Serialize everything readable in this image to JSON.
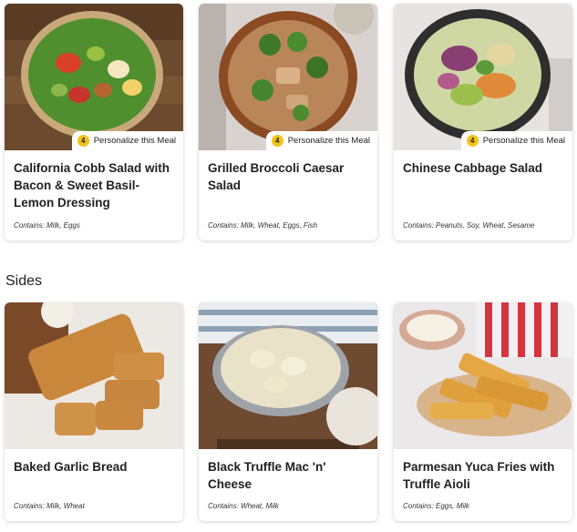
{
  "top_meals": [
    {
      "title": "California Cobb Salad with Bacon & Sweet Basil-Lemon Dressing",
      "contains": "Contains: Milk, Eggs",
      "badge_count": "4",
      "badge_label": "Personalize this Meal"
    },
    {
      "title": "Grilled Broccoli Caesar Salad",
      "contains": "Contains: Milk, Wheat, Eggs, Fish",
      "badge_count": "4",
      "badge_label": "Personalize this Meal"
    },
    {
      "title": "Chinese Cabbage Salad",
      "contains": "Contains: Peanuts, Soy, Wheat, Sesame",
      "badge_count": "4",
      "badge_label": "Personalize this Meal"
    }
  ],
  "sides_section": {
    "title": "Sides",
    "items": [
      {
        "title": "Baked Garlic Bread",
        "contains": "Contains: Milk, Wheat"
      },
      {
        "title": "Black Truffle Mac 'n' Cheese",
        "contains": "Contains: Wheat, Milk"
      },
      {
        "title": "Parmesan Yuca Fries with Truffle Aioli",
        "contains": "Contains: Eggs, Milk"
      }
    ]
  }
}
